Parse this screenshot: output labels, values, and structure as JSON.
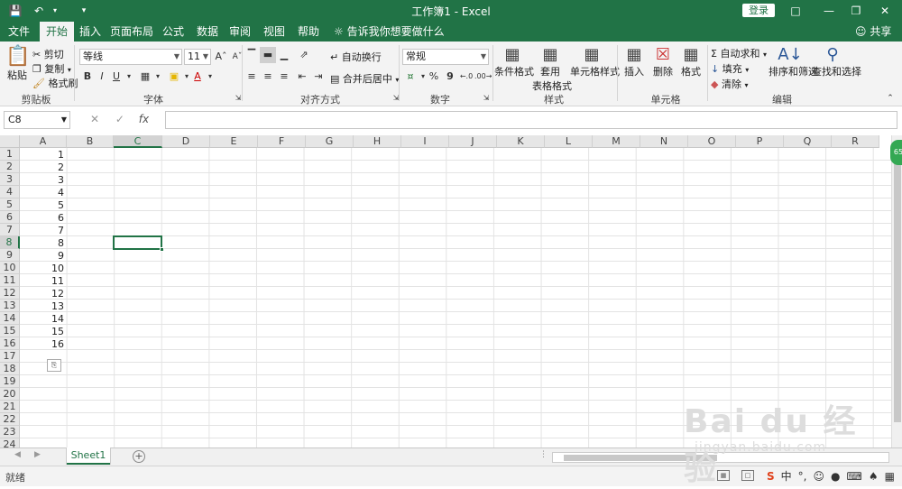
{
  "titlebar": {
    "title": "工作簿1  -  Excel",
    "login": "登录"
  },
  "tabs": [
    "文件",
    "开始",
    "插入",
    "页面布局",
    "公式",
    "数据",
    "审阅",
    "视图",
    "帮助"
  ],
  "tell_me": "告诉我你想要做什么",
  "share": "共享",
  "ribbon": {
    "clipboard": {
      "paste": "粘贴",
      "cut": "剪切",
      "copy": "复制",
      "format_painter": "格式刷",
      "label": "剪贴板"
    },
    "font": {
      "font_name": "等线",
      "font_size": "11",
      "bold": "B",
      "italic": "I",
      "underline": "U",
      "label": "字体"
    },
    "alignment": {
      "wrap_text": "自动换行",
      "merge_center": "合并后居中",
      "label": "对齐方式"
    },
    "number": {
      "format": "常规",
      "percent": "%",
      "comma": "9",
      "label": "数字"
    },
    "styles": {
      "conditional": "条件格式",
      "format_table_1": "套用",
      "format_table_2": "表格格式",
      "cell_styles": "单元格样式",
      "label": "样式"
    },
    "cells": {
      "insert": "插入",
      "delete": "删除",
      "format": "格式",
      "label": "单元格"
    },
    "editing": {
      "autosum": "自动求和",
      "fill": "填充",
      "clear": "清除",
      "sort_filter": "排序和筛选",
      "find_select": "查找和选择",
      "label": "编辑"
    }
  },
  "formula_bar": {
    "name_box": "C8",
    "fx": "fx",
    "value": ""
  },
  "columns": [
    "A",
    "B",
    "C",
    "D",
    "E",
    "F",
    "G",
    "H",
    "I",
    "J",
    "K",
    "L",
    "M",
    "N",
    "O",
    "P",
    "Q",
    "R"
  ],
  "rows": [
    "1",
    "2",
    "3",
    "4",
    "5",
    "6",
    "7",
    "8",
    "9",
    "10",
    "11",
    "12",
    "13",
    "14",
    "15",
    "16",
    "17",
    "18",
    "19",
    "20",
    "21",
    "22",
    "23",
    "24"
  ],
  "column_a_values": [
    "1",
    "2",
    "3",
    "4",
    "5",
    "6",
    "7",
    "8",
    "9",
    "10",
    "11",
    "12",
    "13",
    "14",
    "15",
    "16"
  ],
  "active_cell": "C8",
  "sheets": [
    "Sheet1"
  ],
  "status": "就绪",
  "watermark": {
    "main": "Bai du 经验",
    "sub": "jingyan.baidu.com"
  }
}
